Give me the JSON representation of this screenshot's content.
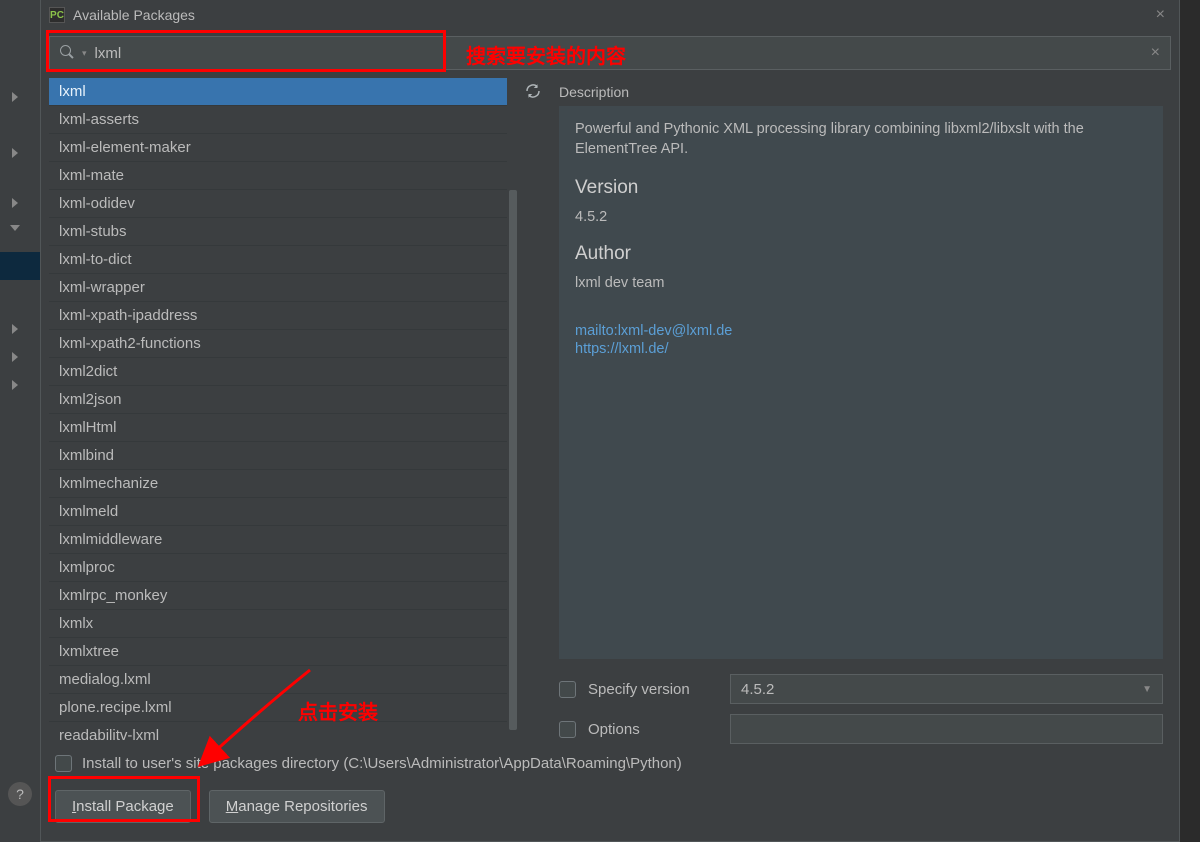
{
  "title": "Available Packages",
  "search": {
    "value": "lxml"
  },
  "annotations": {
    "search_hint": "搜索要安装的内容",
    "install_hint": "点击安装"
  },
  "packages": [
    "lxml",
    "lxml-asserts",
    "lxml-element-maker",
    "lxml-mate",
    "lxml-odidev",
    "lxml-stubs",
    "lxml-to-dict",
    "lxml-wrapper",
    "lxml-xpath-ipaddress",
    "lxml-xpath2-functions",
    "lxml2dict",
    "lxml2json",
    "lxmlHtml",
    "lxmlbind",
    "lxmlmechanize",
    "lxmlmeld",
    "lxmlmiddleware",
    "lxmlproc",
    "lxmlrpc_monkey",
    "lxmlx",
    "lxmlxtree",
    "medialog.lxml",
    "plone.recipe.lxml",
    "readabilitv-lxml"
  ],
  "details": {
    "label": "Description",
    "description": "Powerful and Pythonic XML processing library combining libxml2/libxslt with the ElementTree API.",
    "version_heading": "Version",
    "version": "4.5.2",
    "author_heading": "Author",
    "author": "lxml dev team",
    "mailto": "mailto:lxml-dev@lxml.de",
    "homepage": "https://lxml.de/"
  },
  "options": {
    "specify_version_label": "Specify version",
    "specify_version_value": "4.5.2",
    "options_label": "Options",
    "options_value": ""
  },
  "install_user": {
    "label": "Install to user's site packages directory (C:\\Users\\Administrator\\AppData\\Roaming\\Python)"
  },
  "buttons": {
    "install": "Install Package",
    "manage": "Manage Repositories"
  },
  "bg_icon_text": "PC",
  "help_icon": "?"
}
